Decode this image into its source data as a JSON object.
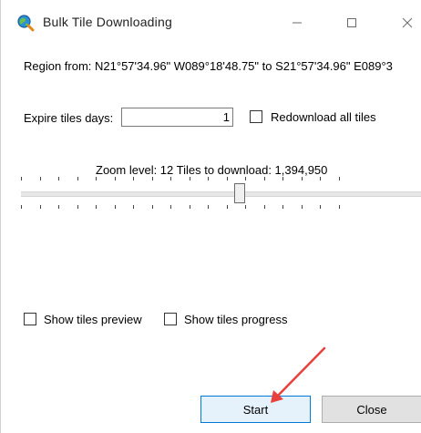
{
  "window": {
    "title": "Bulk Tile Downloading",
    "icon": "magnifier-globe-icon"
  },
  "region": {
    "text": "Region from: N21°57'34.96\" W089°18'48.75\" to S21°57'34.96\" E089°3"
  },
  "expire": {
    "label": "Expire tiles days:",
    "value": "1"
  },
  "redownload": {
    "label": "Redownload all tiles",
    "checked": false
  },
  "zoom": {
    "label": "Zoom level: 12 Tiles to download: 1,394,950",
    "level": 12,
    "tiles": "1,394,950"
  },
  "options": {
    "preview_label": "Show tiles preview",
    "progress_label": "Show tiles progress"
  },
  "buttons": {
    "start": "Start",
    "close": "Close"
  },
  "colors": {
    "annotation": "#e8413b",
    "start_border": "#0078d7"
  }
}
